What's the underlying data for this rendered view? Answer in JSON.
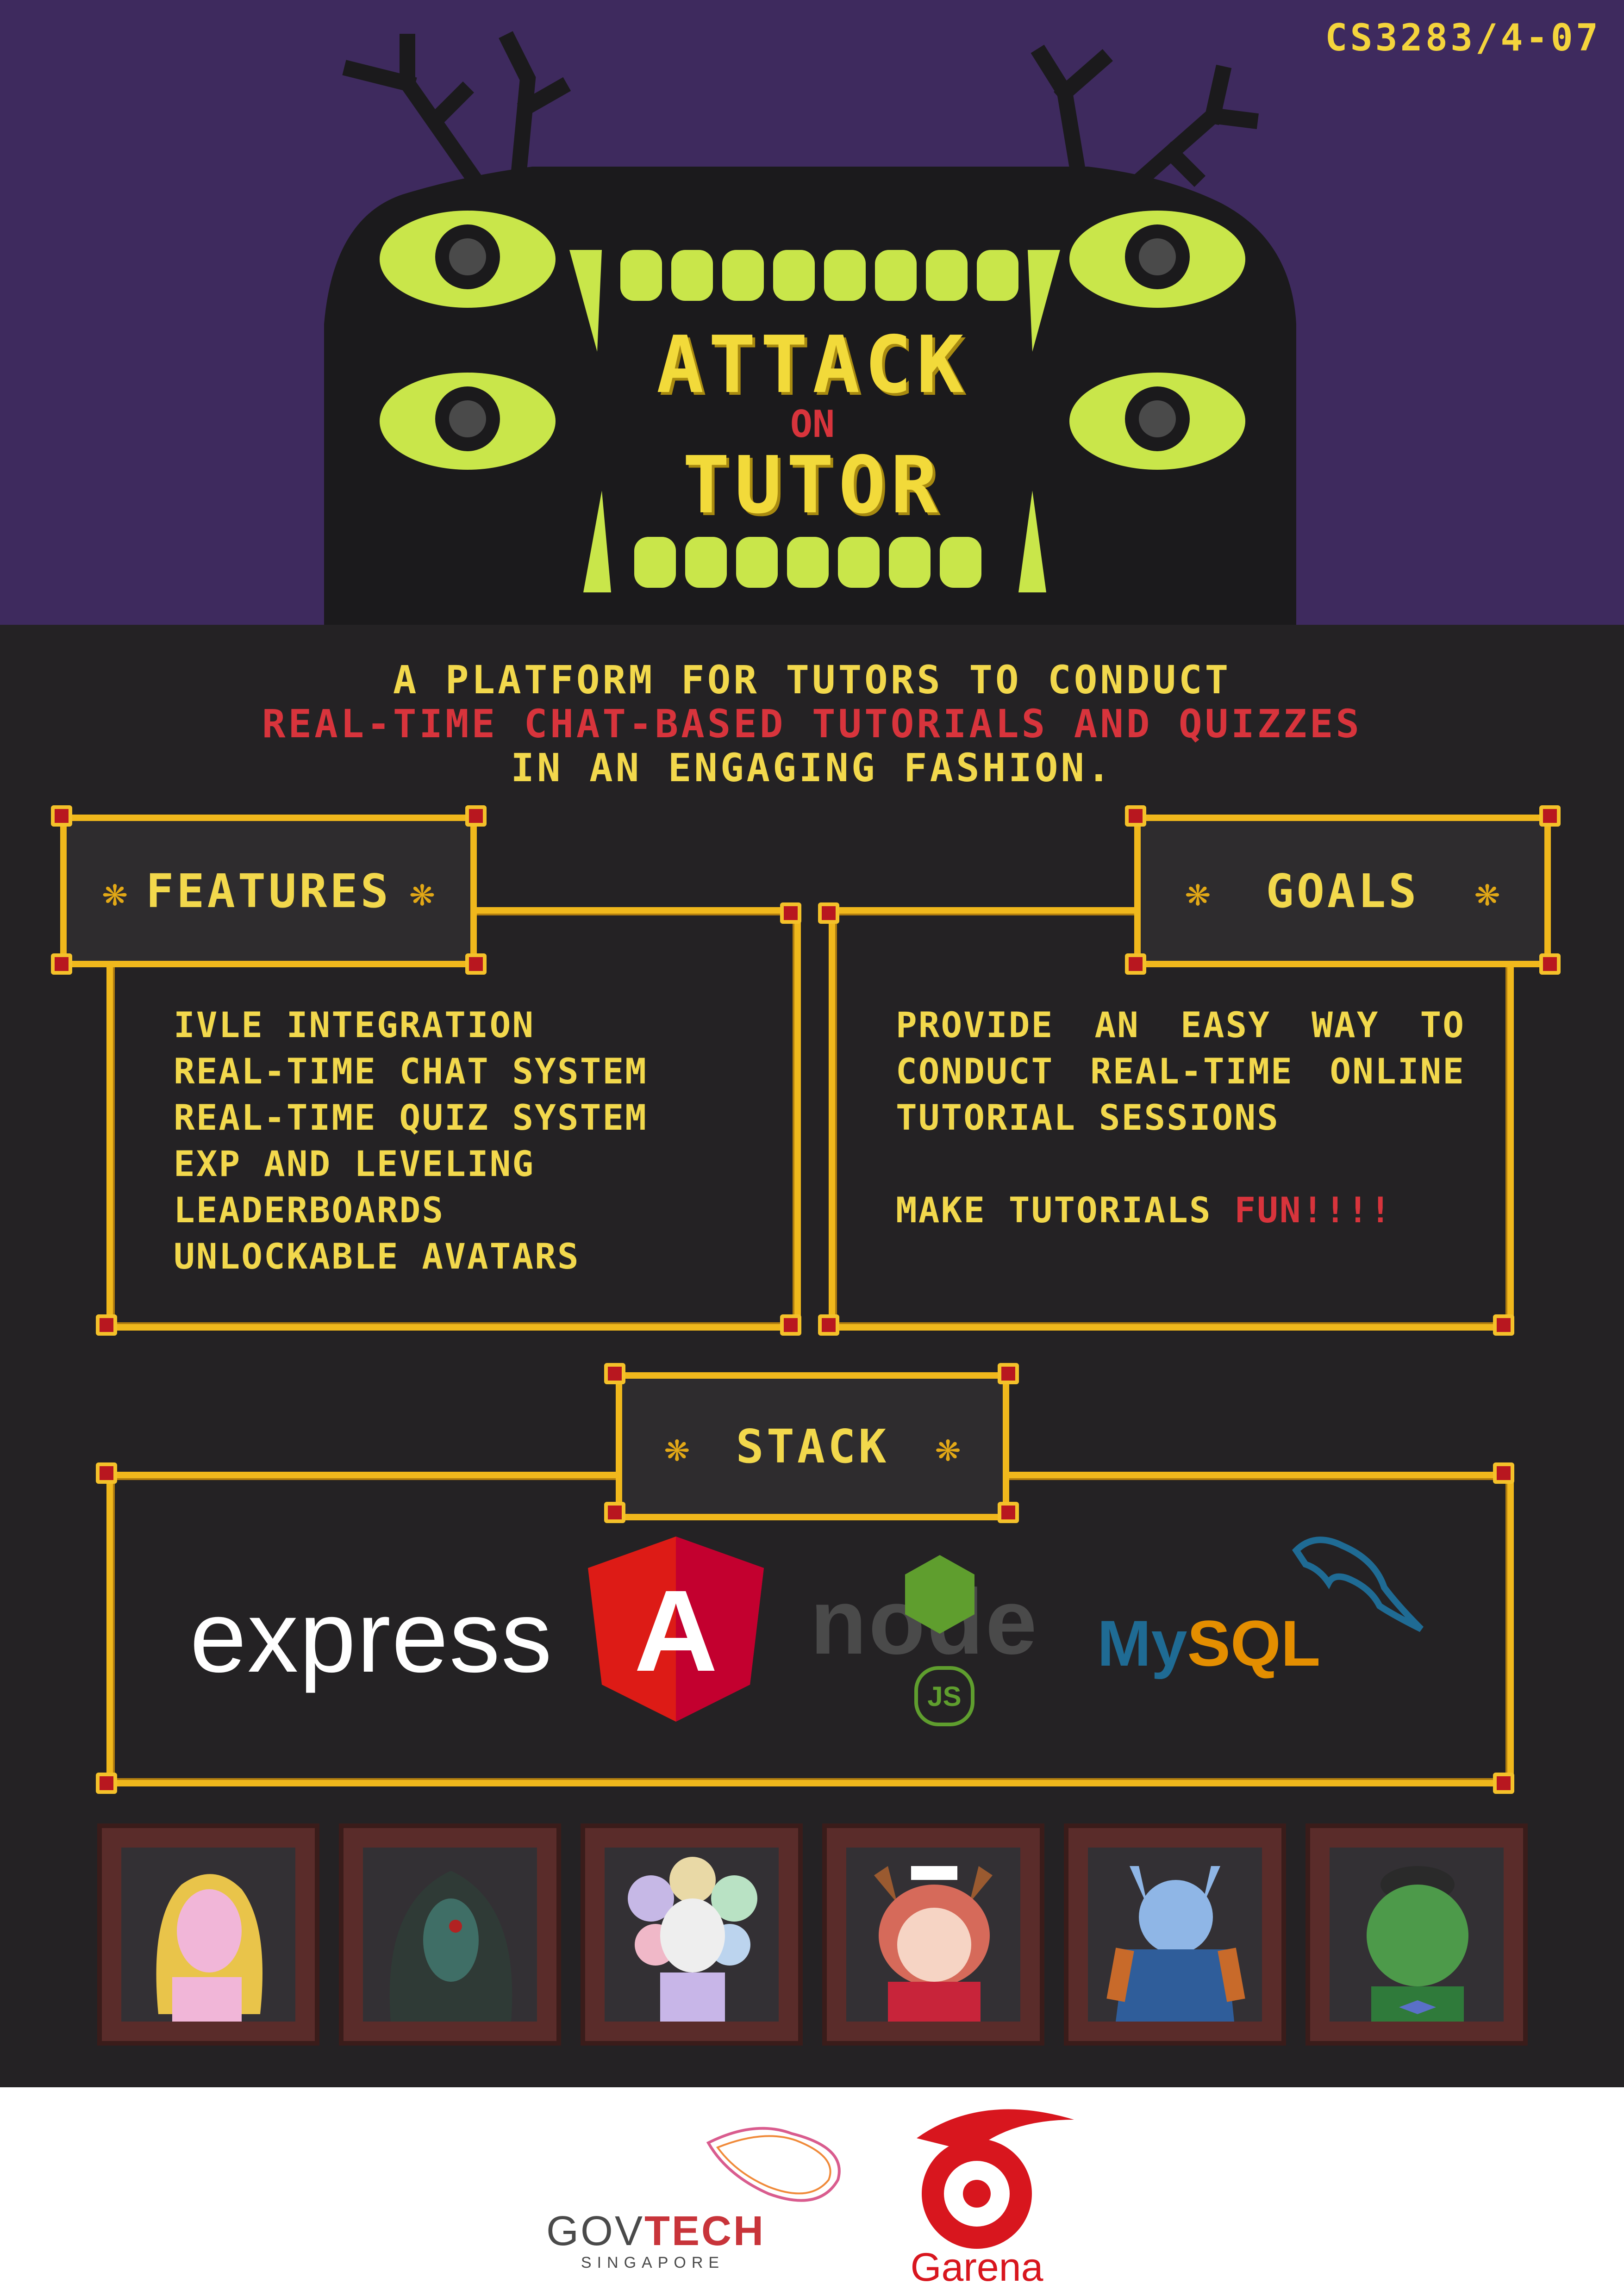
{
  "course_code": "CS3283/4-07",
  "title": {
    "line1": "ATTACK",
    "line2": "ON",
    "line3": "TUTOR"
  },
  "tagline": {
    "line1": "A PLATFORM FOR TUTORS TO CONDUCT",
    "line2": "REAL-TIME CHAT-BASED TUTORIALS AND QUIZZES",
    "line3": "IN AN ENGAGING FASHION."
  },
  "features": {
    "title": "FEATURES",
    "items": [
      "IVLE INTEGRATION",
      "REAL-TIME CHAT SYSTEM",
      "REAL-TIME QUIZ SYSTEM",
      "EXP AND LEVELING",
      "LEADERBOARDS",
      "UNLOCKABLE AVATARS"
    ]
  },
  "goals": {
    "title": "GOALS",
    "line1": "PROVIDE AN EASY WAY TO",
    "line2": "CONDUCT REAL-TIME ONLINE",
    "line3": "TUTORIAL SESSIONS",
    "line4_prefix": "MAKE TUTORIALS ",
    "line4_highlight": "FUN!!!!"
  },
  "stack": {
    "title": "STACK",
    "express": "express",
    "angular": "A",
    "node": "node",
    "node_js": "JS",
    "mysql_my": "My",
    "mysql_sql": "SQL"
  },
  "avatars": [
    "blonde-girl-avatar",
    "hooded-zombie-avatar",
    "flower-ghost-avatar",
    "horned-maid-avatar",
    "blue-demon-avatar",
    "green-orc-avatar"
  ],
  "sponsors": {
    "govtech_main_a": "GOV",
    "govtech_main_b": "TECH",
    "govtech_sub": "SINGAPORE",
    "garena": "Garena"
  },
  "colors": {
    "purple": "#3e2a5e",
    "dark": "#242224",
    "gold": "#f0b81c",
    "yellow_text": "#f2d84c",
    "red_text": "#d8343c",
    "lime": "#c9e64a"
  }
}
